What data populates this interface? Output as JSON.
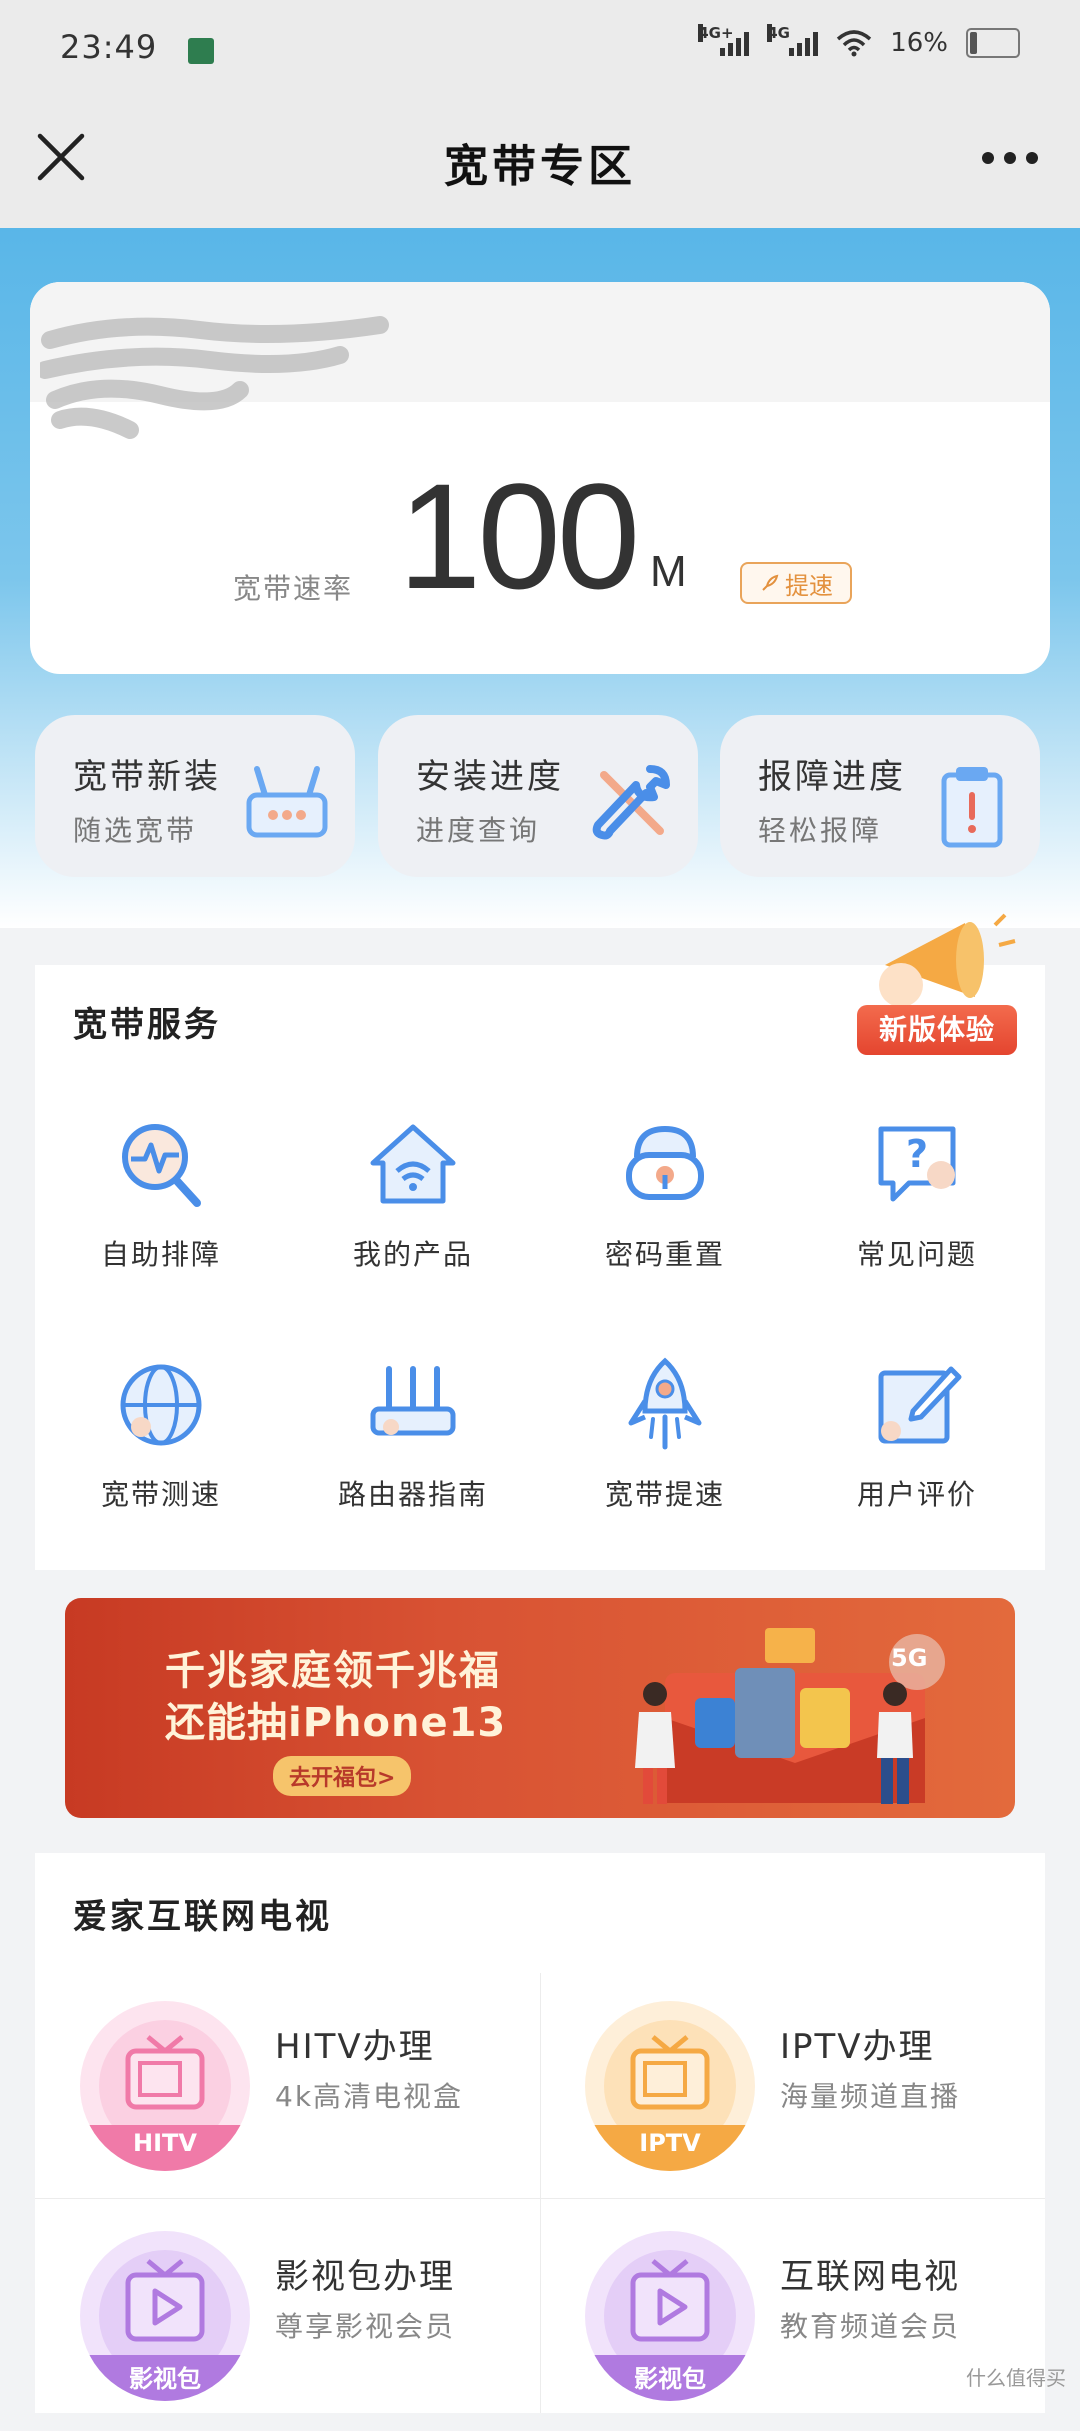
{
  "status_bar": {
    "time": "23:49",
    "signal1_label": "4G+",
    "signal2_label": "4G",
    "battery_percent": "16%",
    "battery_level": 0.16
  },
  "header": {
    "title": "宽带专区"
  },
  "speed_card": {
    "label": "宽带速率",
    "value": "100",
    "unit": "M",
    "speedup_label": "提速"
  },
  "quick_cards": [
    {
      "title": "宽带新装",
      "subtitle": "随选宽带",
      "icon": "router-icon"
    },
    {
      "title": "安装进度",
      "subtitle": "进度查询",
      "icon": "wrench-screwdriver-icon"
    },
    {
      "title": "报障进度",
      "subtitle": "轻松报障",
      "icon": "clipboard-alert-icon"
    }
  ],
  "service": {
    "title": "宽带服务",
    "badge": "新版体验",
    "items": [
      {
        "label": "自助排障",
        "icon": "diagnosis-icon"
      },
      {
        "label": "我的产品",
        "icon": "home-wifi-icon"
      },
      {
        "label": "密码重置",
        "icon": "lock-reset-icon"
      },
      {
        "label": "常见问题",
        "icon": "faq-icon"
      },
      {
        "label": "宽带测速",
        "icon": "globe-icon"
      },
      {
        "label": "路由器指南",
        "icon": "router-guide-icon"
      },
      {
        "label": "宽带提速",
        "icon": "rocket-icon"
      },
      {
        "label": "用户评价",
        "icon": "edit-review-icon"
      }
    ]
  },
  "banner": {
    "line1": "千兆家庭领千兆福",
    "line2": "还能抽iPhone13",
    "button": "去开福包>",
    "badge": "5G"
  },
  "tv": {
    "title": "爱家互联网电视",
    "items": [
      {
        "name": "HITV办理",
        "subtitle": "4k高清电视盒",
        "tag": "HITV",
        "color": "#f07aa8"
      },
      {
        "name": "IPTV办理",
        "subtitle": "海量频道直播",
        "tag": "IPTV",
        "color": "#f5a944"
      },
      {
        "name": "影视包办理",
        "subtitle": "尊享影视会员",
        "tag": "影视包",
        "color": "#b07ae0"
      },
      {
        "name": "互联网电视",
        "subtitle": "教育频道会员",
        "tag": "影视包",
        "color": "#b07ae0"
      }
    ]
  },
  "watermark": "什么值得买"
}
